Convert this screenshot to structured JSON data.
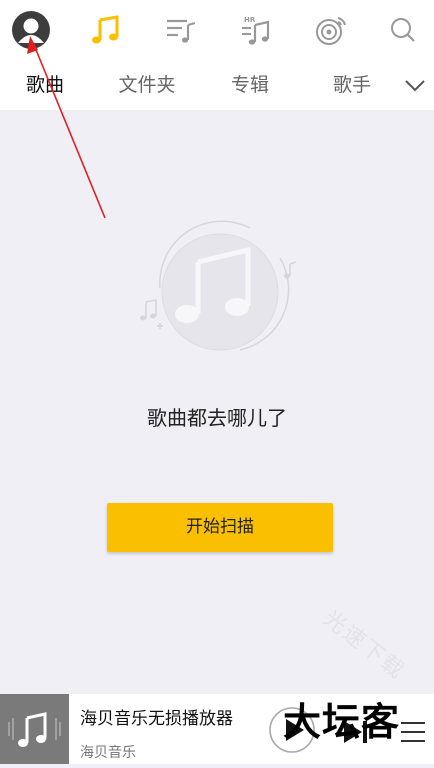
{
  "tabs": [
    "歌曲",
    "文件夹",
    "专辑",
    "歌手"
  ],
  "empty_message": "歌曲都去哪儿了",
  "scan_button": "开始扫描",
  "now_playing": {
    "title": "海贝音乐无损播放器",
    "artist": "海贝音乐"
  },
  "overlay_logo": "大坛客",
  "watermark": "光速下载",
  "top_icons": [
    "avatar-icon",
    "music-note-icon",
    "playlist-icon",
    "hr-music-icon",
    "radio-disc-icon",
    "search-icon"
  ],
  "colors": {
    "accent": "#fac000",
    "background": "#f0eff5",
    "annotation": "#e02020"
  }
}
